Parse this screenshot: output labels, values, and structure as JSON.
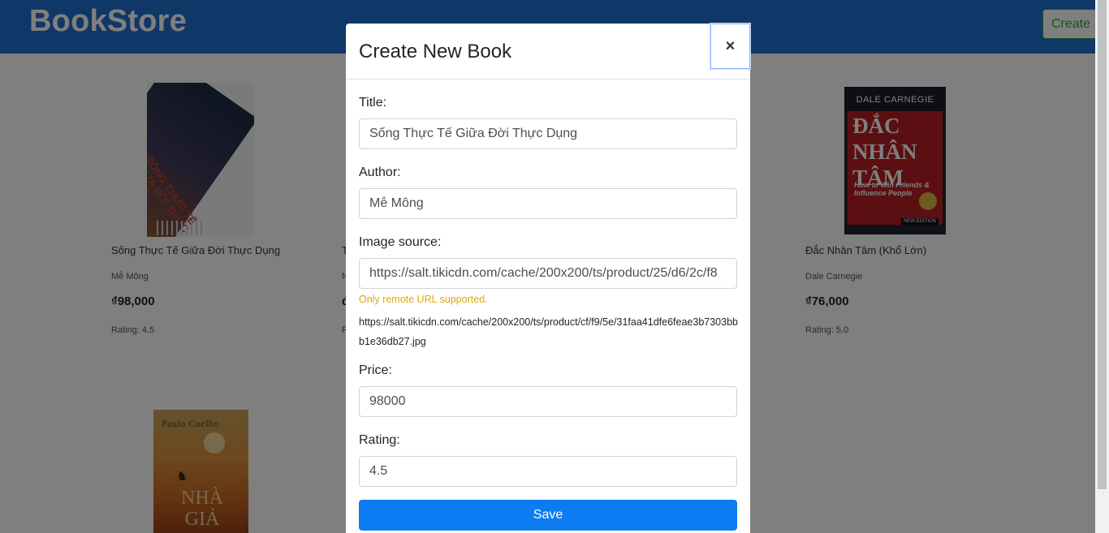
{
  "navbar": {
    "brand": "BookStore",
    "create_label": "Create"
  },
  "books": [
    {
      "title": "Sống Thực Tế Giữa Đời Thực Dụng",
      "author": "Mễ Mông",
      "price": "₫98,000",
      "rating": "Rating: 4.5"
    },
    {
      "title": "Đắc Nhân Tâm (Khổ Lớn)",
      "author": "Dale Carnegie",
      "price": "₫76,000",
      "rating": "Rating: 5.0"
    },
    {
      "title": "",
      "author": "",
      "price": "",
      "rating": ""
    }
  ],
  "partial_card_glyphs": {
    "title": "T",
    "author": "N",
    "price": "đ",
    "rating": "R"
  },
  "covers": {
    "book1": {
      "text": "SỐNG THỰC TẾ GIỮA ĐỜI THỰC DỤNG"
    },
    "book2": {
      "author": "DALE CARNEGIE",
      "title_lines": [
        "ĐẮC",
        "NHÂN",
        "TÂM"
      ],
      "subtitle": "How to Win Friends & Influence People",
      "edition": "NEW EDITION"
    },
    "book3": {
      "author": "Paulo Coelho",
      "title_lines": [
        "NHÀ",
        "GIẢ KIM"
      ]
    }
  },
  "modal": {
    "title": "Create New Book",
    "close_label": "×",
    "fields": {
      "title": {
        "label": "Title:",
        "value": "Sống Thực Tế Giữa Đời Thực Dụng"
      },
      "author": {
        "label": "Author:",
        "value": "Mễ Mông"
      },
      "image": {
        "label": "Image source:",
        "value": "https://salt.tikicdn.com/cache/200x200/ts/product/25/d6/2c/f8",
        "hint": "Only remote URL supported.",
        "preview_url": "https://salt.tikicdn.com/cache/200x200/ts/product/cf/f9/5e/31faa41dfe6feae3b7303bbb1e36db27.jpg"
      },
      "price": {
        "label": "Price:",
        "value": "98000"
      },
      "rating": {
        "label": "Rating:",
        "value": "4.5"
      }
    },
    "save_label": "Save"
  },
  "colors": {
    "navbar": "#1e6fd1",
    "create_button": "#28a745",
    "save_button": "#0d7cf2",
    "hint": "#e0a800"
  }
}
